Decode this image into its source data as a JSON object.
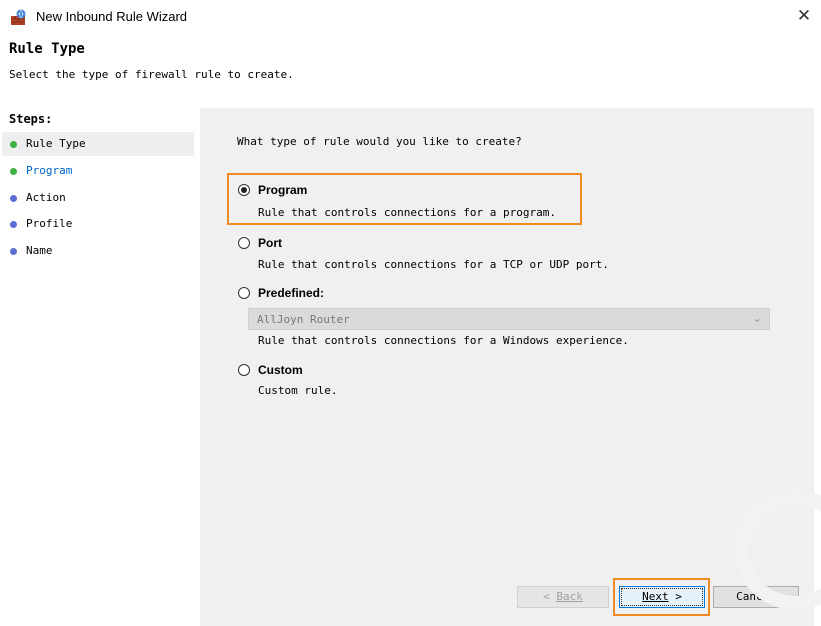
{
  "window": {
    "title": "New Inbound Rule Wizard",
    "close_glyph": "✕"
  },
  "header": {
    "title": "Rule Type",
    "subtitle": "Select the type of firewall rule to create."
  },
  "steps": {
    "heading": "Steps:",
    "items": [
      {
        "label": "Rule Type",
        "dot_color": "#3cb043",
        "active": true
      },
      {
        "label": "Program",
        "dot_color": "#3cb043",
        "active": false
      },
      {
        "label": "Action",
        "dot_color": "#5a6fd1",
        "active": false
      },
      {
        "label": "Profile",
        "dot_color": "#5a6fd1",
        "active": false
      },
      {
        "label": "Name",
        "dot_color": "#5a6fd1",
        "active": false
      }
    ]
  },
  "main": {
    "question": "What type of rule would you like to create?",
    "options": [
      {
        "title": "Program",
        "desc": "Rule that controls connections for a program.",
        "selected": true
      },
      {
        "title": "Port",
        "desc": "Rule that controls connections for a TCP or UDP port.",
        "selected": false
      },
      {
        "title": "Predefined:",
        "desc": "Rule that controls connections for a Windows experience.",
        "selected": false
      },
      {
        "title": "Custom",
        "desc": "Custom rule.",
        "selected": false
      }
    ],
    "predefined_select": {
      "value": "AllJoyn Router",
      "enabled": false
    }
  },
  "buttons": {
    "back_glyph": "<",
    "back_label": "Back",
    "next_label": "Next",
    "next_glyph": ">",
    "cancel_label": "Cancel"
  },
  "colors": {
    "highlight": "#f08a24",
    "panel_bg": "#f0f0f0",
    "accent": "#0078d7"
  }
}
